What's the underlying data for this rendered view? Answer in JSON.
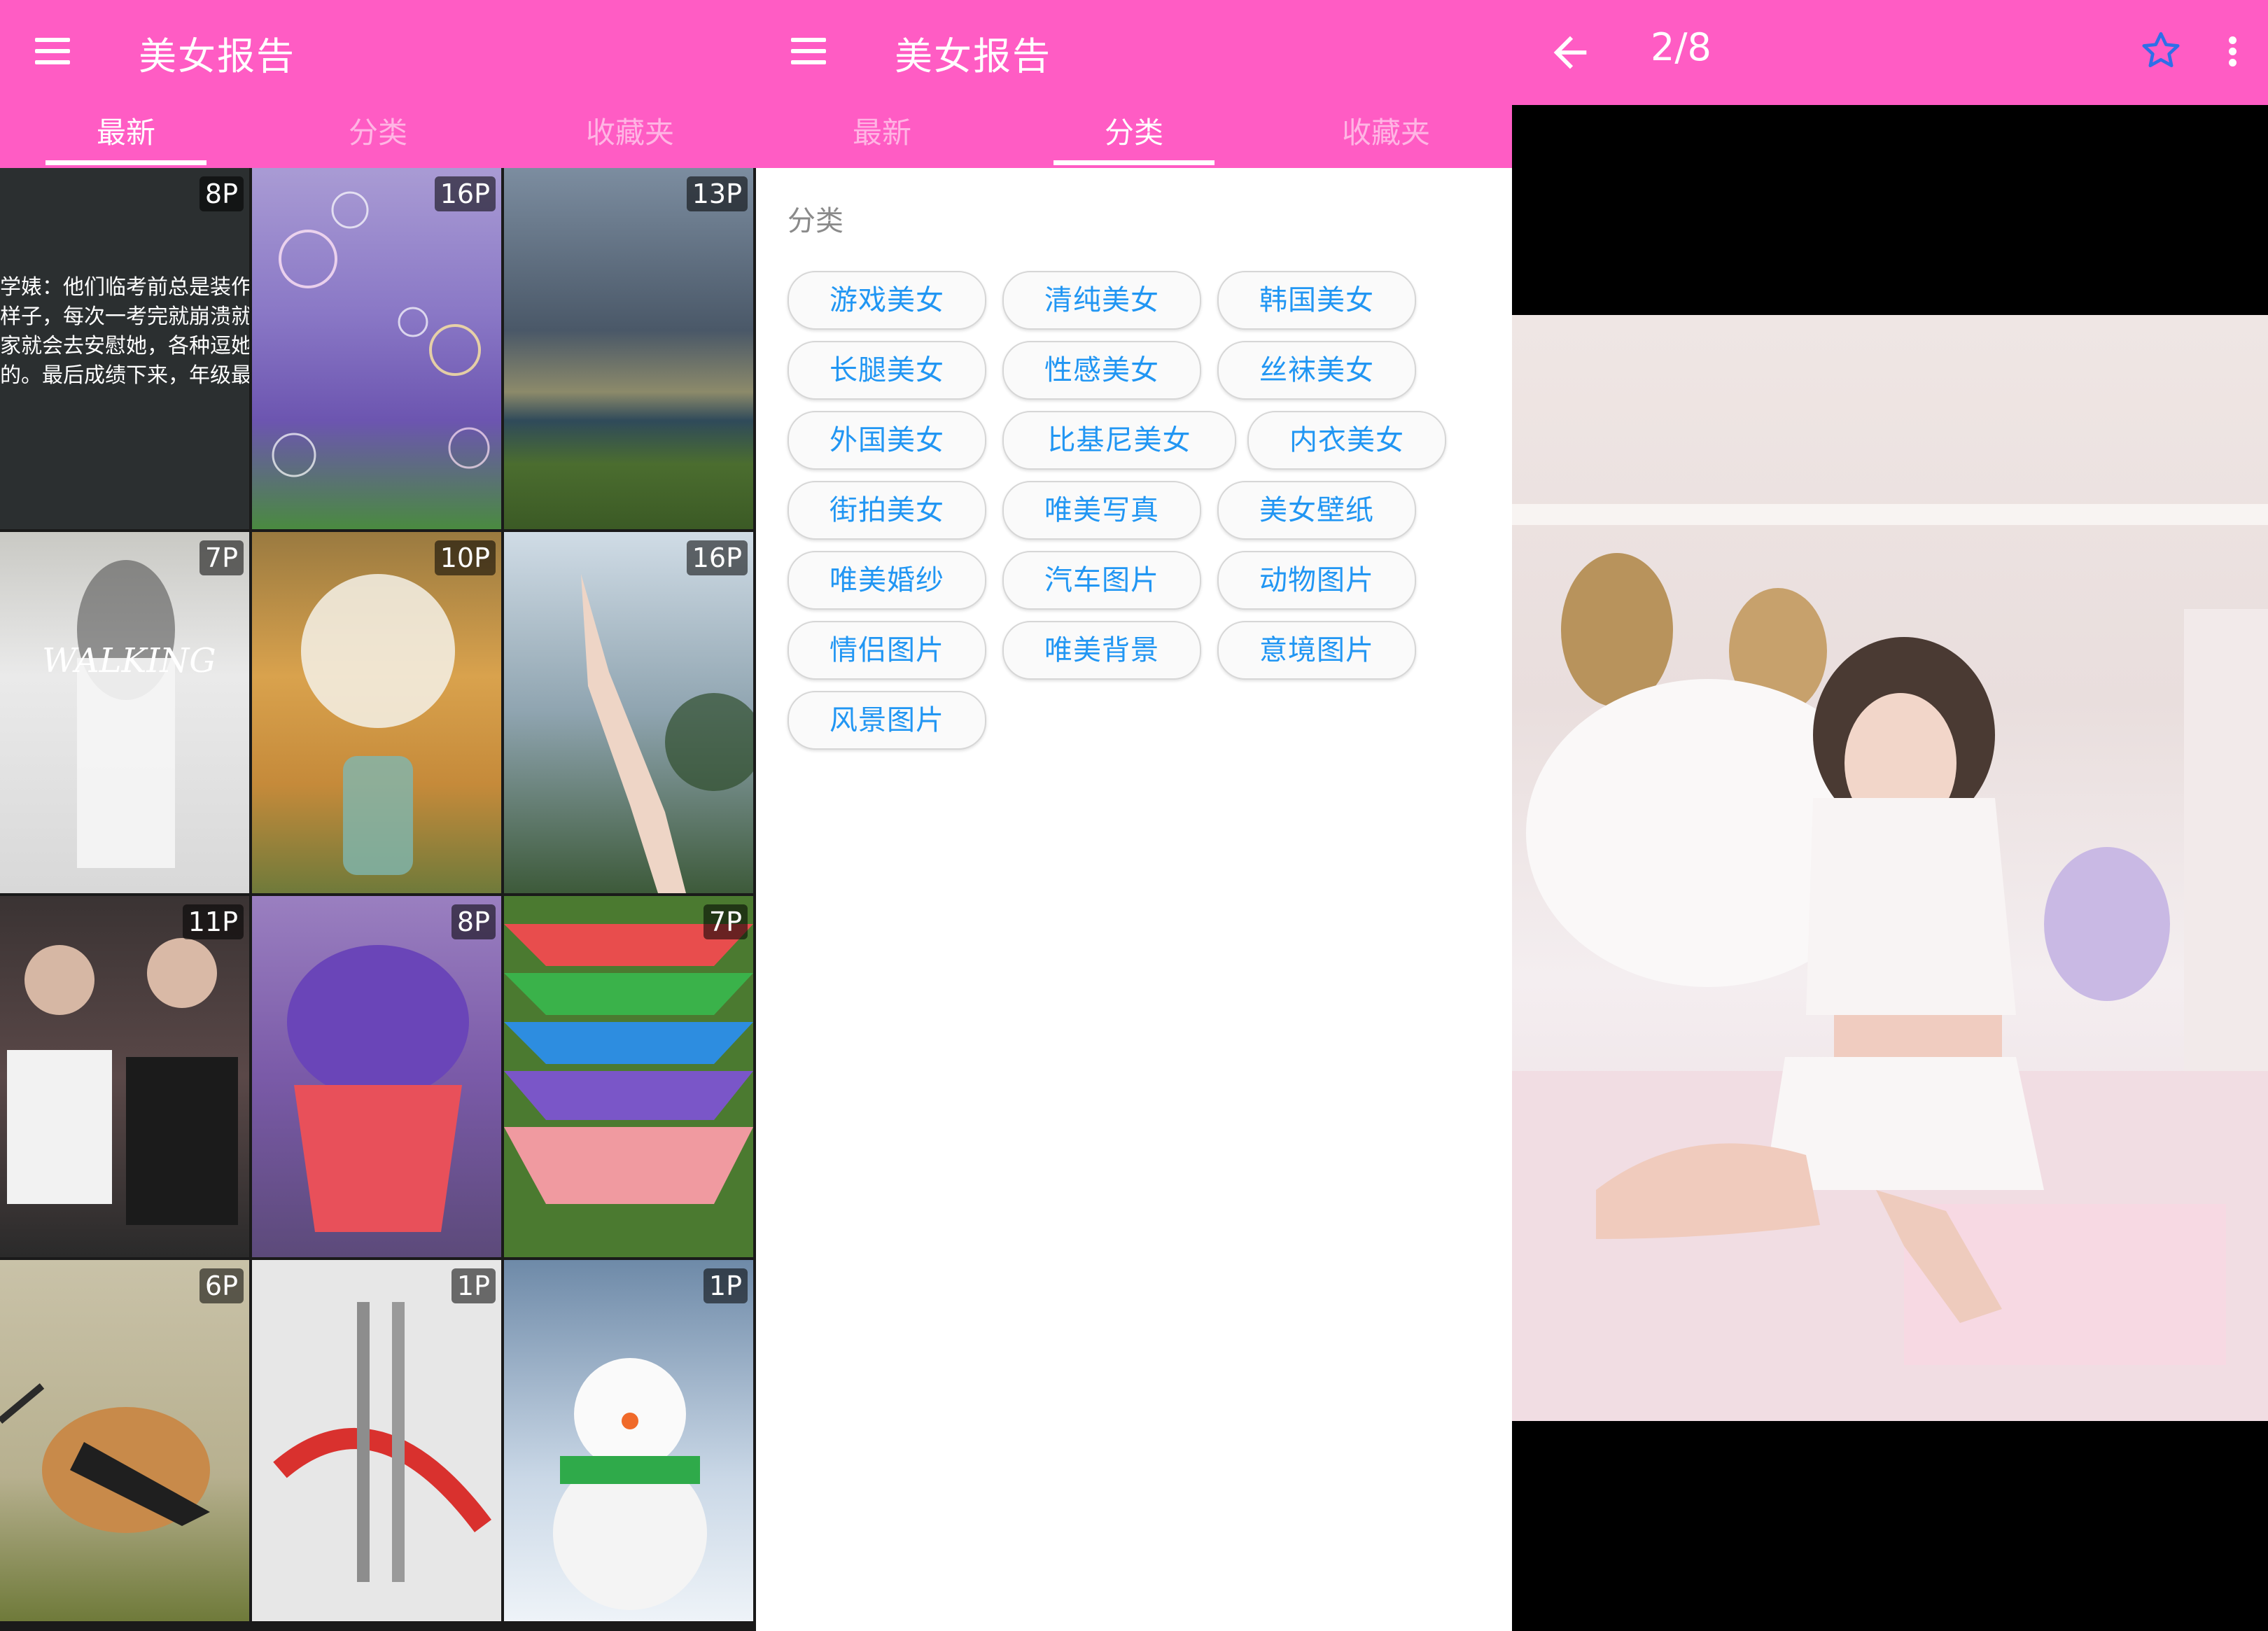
{
  "app_title": "美女报告",
  "tabs": [
    "最新",
    "分类",
    "收藏夹"
  ],
  "latest": {
    "tiles": [
      {
        "badge": "8P",
        "text": [
          "学婊：他们临考前总是装作",
          "样子，每次一考完就崩溃就",
          "家就会去安慰她，各种逗她",
          "的。最后成绩下来，年级最"
        ]
      },
      {
        "badge": "16P"
      },
      {
        "badge": "13P"
      },
      {
        "badge": "7P"
      },
      {
        "badge": "10P"
      },
      {
        "badge": "16P"
      },
      {
        "badge": "11P"
      },
      {
        "badge": "8P"
      },
      {
        "badge": "7P"
      },
      {
        "badge": "6P"
      },
      {
        "badge": "1P"
      },
      {
        "badge": "1P"
      }
    ]
  },
  "categories": {
    "heading": "分类",
    "chips": [
      "游戏美女",
      "清纯美女",
      "韩国美女",
      "长腿美女",
      "性感美女",
      "丝袜美女",
      "外国美女",
      "比基尼美女",
      "内衣美女",
      "街拍美女",
      "唯美写真",
      "美女壁纸",
      "唯美婚纱",
      "汽车图片",
      "动物图片",
      "情侣图片",
      "唯美背景",
      "意境图片",
      "风景图片"
    ]
  },
  "viewer": {
    "counter": "2/8",
    "icons": [
      "back-arrow-icon",
      "star-outline-icon",
      "more-vert-icon"
    ]
  },
  "colors": {
    "appbar": "#ff5cc4",
    "chip_text": "#2196f3"
  }
}
